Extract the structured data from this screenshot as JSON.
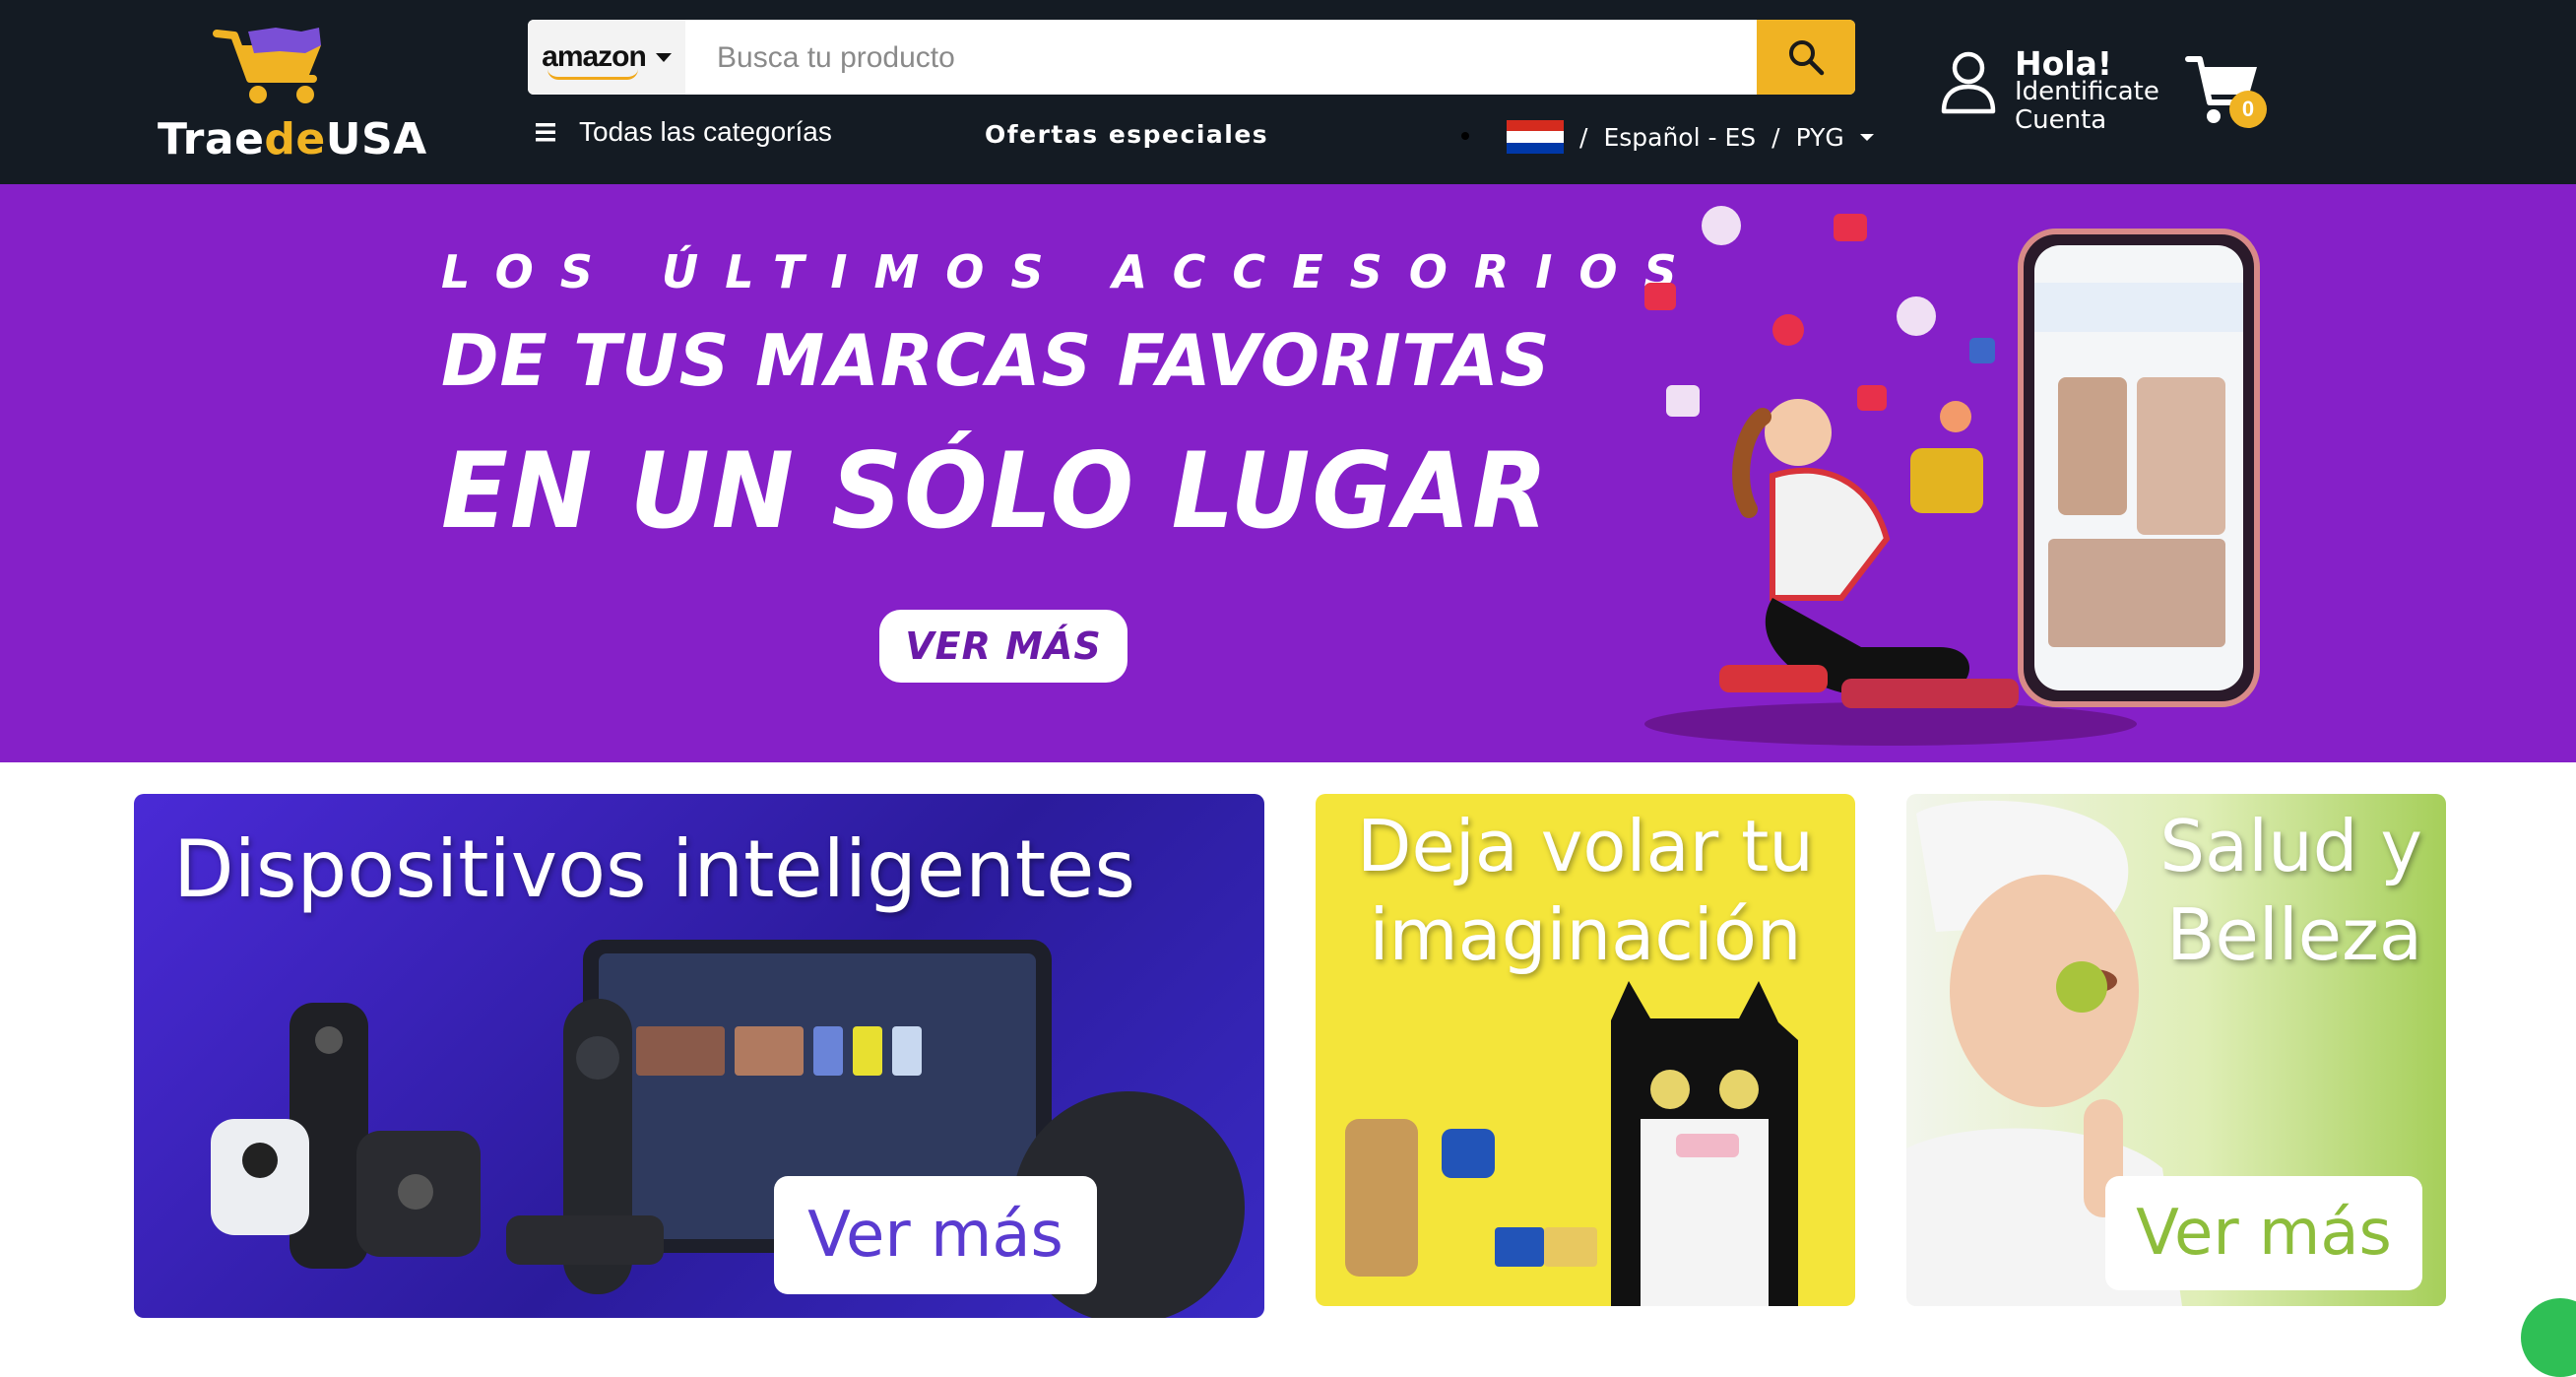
{
  "header": {
    "logo": {
      "part1": "Trae",
      "part2": "de",
      "part3": "USA"
    },
    "search": {
      "store": "amazon",
      "placeholder": "Busca tu producto",
      "button_icon": "search-icon"
    },
    "nav": {
      "categories": "Todas las categorías",
      "deals": "Ofertas especiales"
    },
    "locale": {
      "sep": "/",
      "language": "Español - ES",
      "currency": "PYG"
    },
    "account": {
      "greeting": "Hola!",
      "line1": "Identificate",
      "line2": "Cuenta"
    },
    "cart": {
      "count": "0"
    }
  },
  "hero": {
    "line1": "LOS ÚLTIMOS ACCESORIOS",
    "line2": "DE TUS MARCAS FAVORITAS",
    "line3": "EN UN SÓLO LUGAR",
    "button": "VER MÁS"
  },
  "promos": {
    "devices": {
      "title": "Dispositivos inteligentes",
      "button": "Ver más"
    },
    "toys": {
      "title_line1": "Deja volar tu",
      "title_line2": "imaginación"
    },
    "beauty": {
      "title_line1": "Salud y",
      "title_line2": "Belleza",
      "button": "Ver más"
    }
  },
  "colors": {
    "header_bg": "#141b23",
    "accent": "#f0b323",
    "hero_bg": "#8520c8",
    "toys_bg": "#f4e53a"
  },
  "icons": [
    "search-icon",
    "menu-icon",
    "user-icon",
    "cart-icon",
    "chevron-down-icon",
    "paraguay-flag-icon",
    "whatsapp-icon"
  ]
}
